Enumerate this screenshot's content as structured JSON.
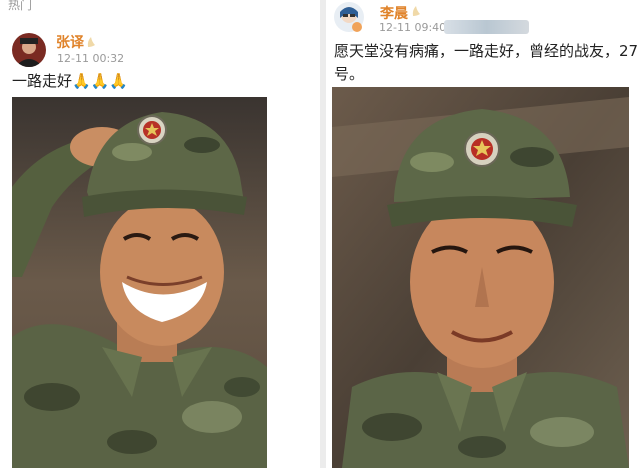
{
  "left_post": {
    "hot_label": "热门",
    "username": "张译",
    "timestamp": "12-11 00:32",
    "text": "一路走好🙏🙏🙏",
    "avatar_icon": "user-avatar",
    "photo_icon": "soldier-smiling-photo"
  },
  "right_post": {
    "username": "李晨",
    "timestamp": "12-11 09:40",
    "text_line1": "愿天堂没有病痛，一路走好，曾经的战友，27",
    "text_line2": "号。",
    "avatar_icon": "user-avatar",
    "photo_icon": "soldier-portrait-photo"
  },
  "colors": {
    "username": "#e0832a",
    "camo_dark": "#4f5a3c",
    "camo_light": "#7d8760"
  }
}
